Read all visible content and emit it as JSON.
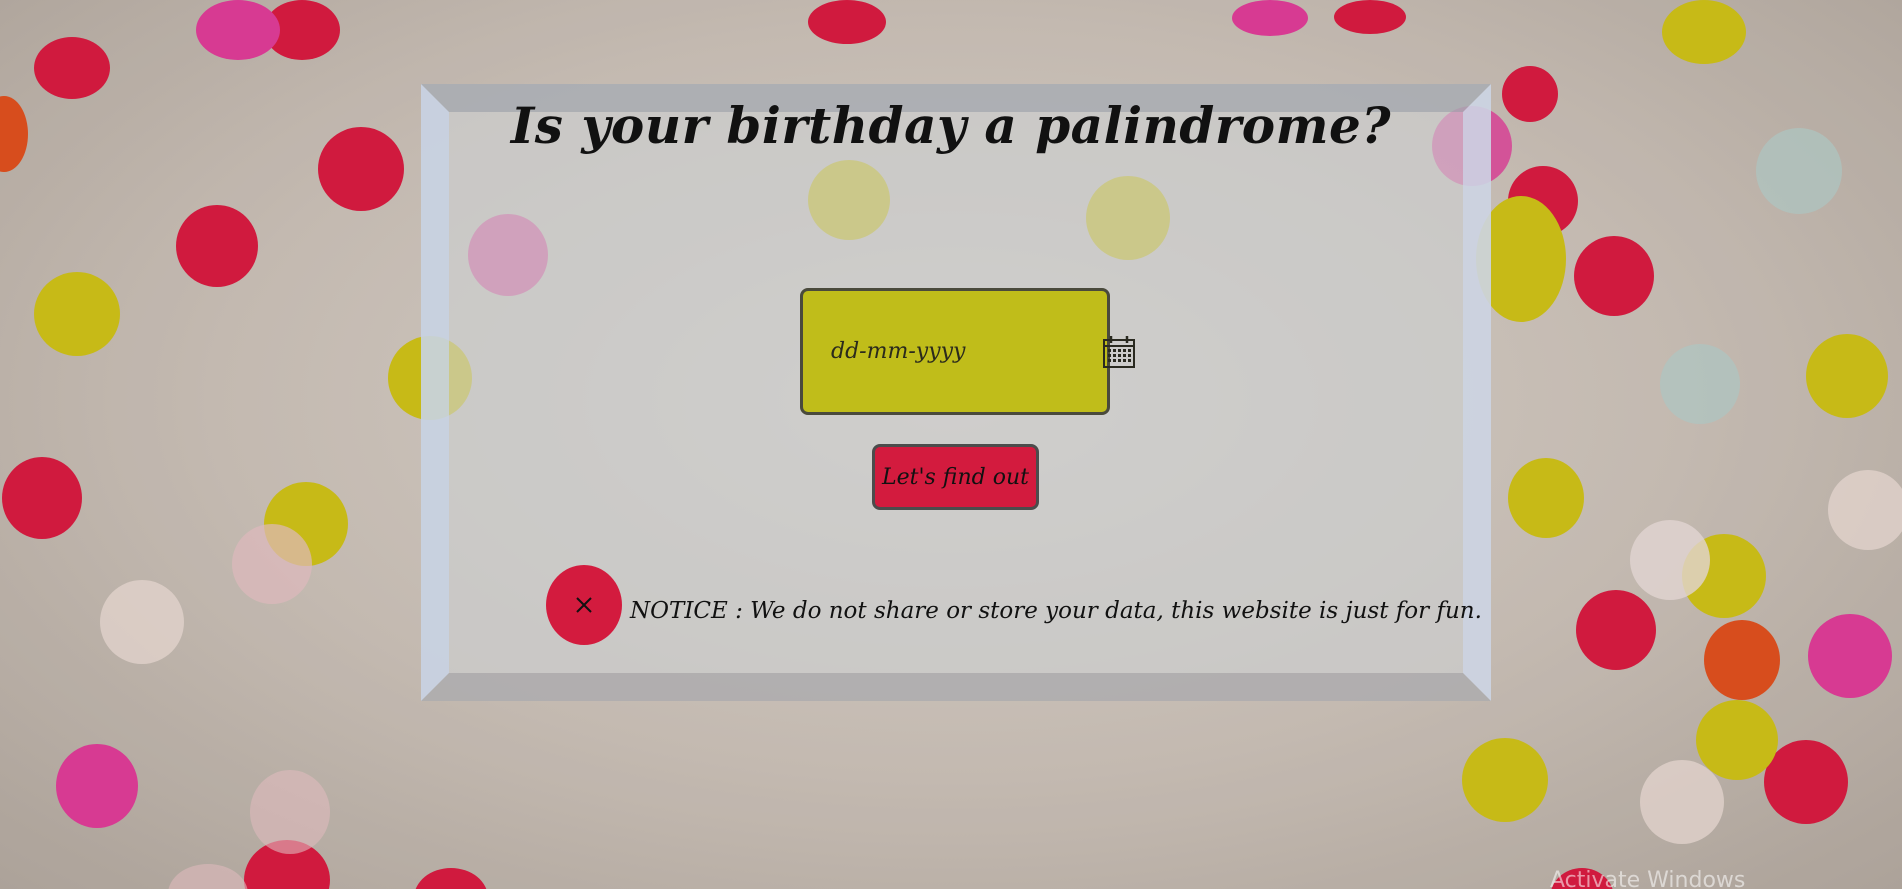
{
  "page": {
    "title": "Is your birthday a palindrome?"
  },
  "form": {
    "date_placeholder": "dd-mm-yyyy",
    "date_value": "",
    "calendar_icon": "calendar-icon",
    "submit_label": "Let's find out"
  },
  "notice": {
    "close_icon": "close-icon",
    "text": "NOTICE : We do not share or store your data, this website is just for fun."
  },
  "system": {
    "watermark": "Activate Windows"
  },
  "colors": {
    "date_box": "#c0bd1a",
    "button": "#d31b3e",
    "confetti_red": "#e0173f",
    "confetti_yellow": "#d6c914",
    "confetti_pink": "#e83a9c"
  }
}
